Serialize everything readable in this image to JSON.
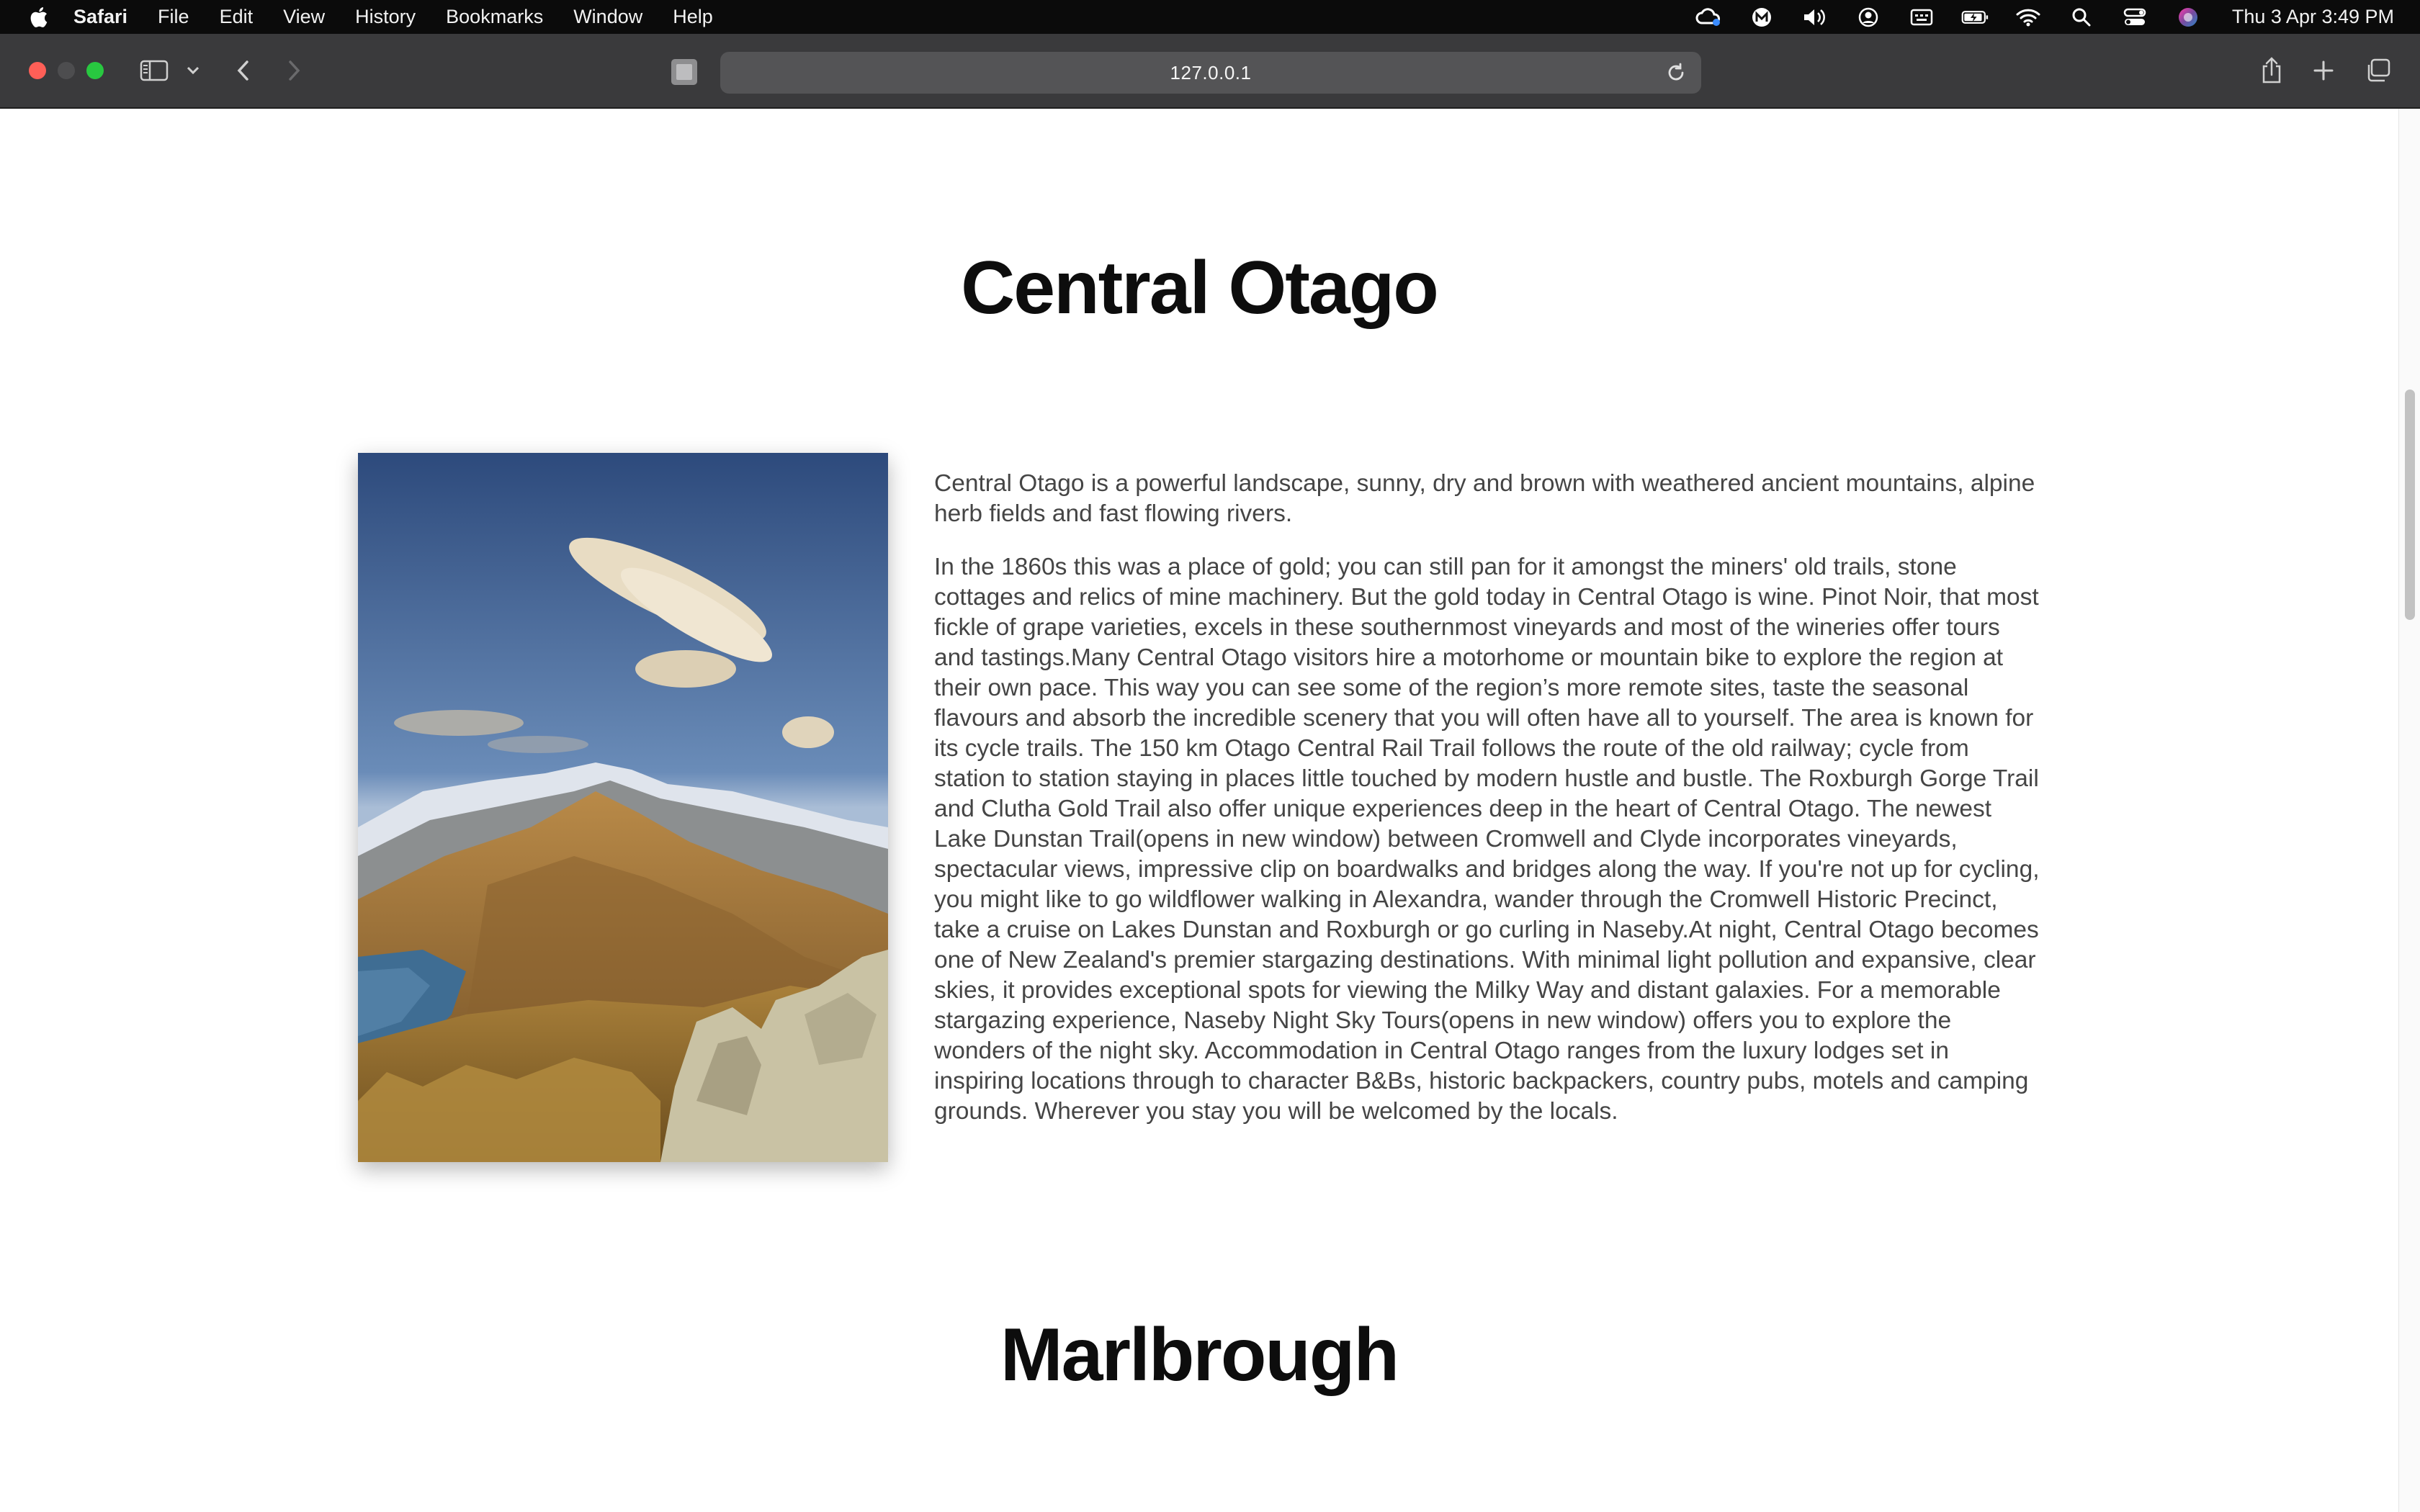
{
  "menubar": {
    "app_name": "Safari",
    "items": [
      "File",
      "Edit",
      "View",
      "History",
      "Bookmarks",
      "Window",
      "Help"
    ],
    "clock": "Thu 3 Apr  3:49 PM",
    "status_icons": [
      "creative-cloud-icon",
      "malwarebytes-icon",
      "volume-icon",
      "user-icon",
      "keyboard-icon",
      "battery-icon",
      "wifi-icon",
      "search-icon",
      "control-center-icon",
      "siri-icon"
    ]
  },
  "browser": {
    "url": "127.0.0.1"
  },
  "page": {
    "section1_title": "Central Otago",
    "section1_paragraph1": "Central Otago is a powerful landscape, sunny, dry and brown with weathered ancient mountains, alpine herb fields and fast flowing rivers.",
    "section1_paragraph2": "In the 1860s this was a place of gold; you can still pan for it amongst the miners' old trails, stone cottages and relics of mine machinery. But the gold today in Central Otago is wine. Pinot Noir, that most fickle of grape varieties, excels in these southernmost vineyards and most of the wineries offer tours and tastings.Many Central Otago visitors hire a motorhome or mountain bike to explore the region at their own pace. This way you can see some of the region’s more remote sites, taste the seasonal flavours and absorb the incredible scenery that you will often have all to yourself. The area is known for its cycle trails. The 150 km Otago Central Rail Trail follows the route of the old railway; cycle from station to station staying in places little touched by modern hustle and bustle. The Roxburgh Gorge Trail and Clutha Gold Trail also offer unique experiences deep in the heart of Central Otago. The newest Lake Dunstan Trail(opens in new window) between Cromwell and Clyde incorporates vineyards, spectacular views, impressive clip on boardwalks and bridges along the way. If you're not up for cycling, you might like to go wildflower walking in Alexandra, wander through the Cromwell Historic Precinct, take a cruise on Lakes Dunstan and Roxburgh or go curling in Naseby.At night, Central Otago becomes one of New Zealand's premier stargazing destinations. With minimal light pollution and expansive, clear skies, it provides exceptional spots for viewing the Milky Way and distant galaxies. For a memorable stargazing experience, Naseby Night Sky Tours(opens in new window) offers you to explore the wonders of the night sky. Accommodation in Central Otago ranges from the luxury lodges set in inspiring locations through to character B&Bs, historic backpackers, country pubs, motels and camping grounds. Wherever you stay you will be welcomed by the locals.",
    "section2_title": "Marlbrough"
  },
  "colors": {
    "menubar_bg": "#0b0b0b",
    "toolbar_bg": "#3a3a3c",
    "urlbar_bg": "#545456",
    "close": "#ff5f57",
    "minimize": "#4d4d4f",
    "maximize": "#28c840",
    "heading": "#0d0d0d",
    "body_text": "#454545"
  }
}
